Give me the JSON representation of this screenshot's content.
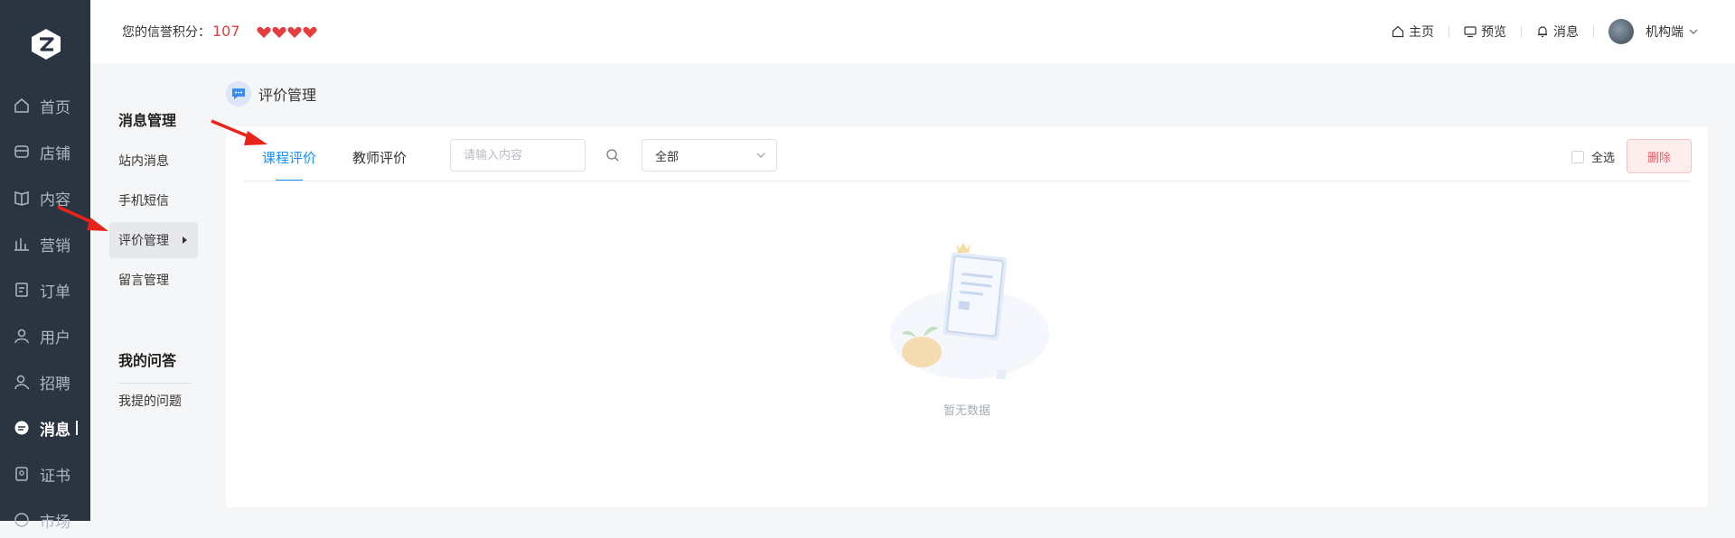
{
  "nav": {
    "items": [
      {
        "label": "首页",
        "icon": "home-icon"
      },
      {
        "label": "店铺",
        "icon": "store-icon"
      },
      {
        "label": "内容",
        "icon": "book-icon"
      },
      {
        "label": "营销",
        "icon": "chart-icon"
      },
      {
        "label": "订单",
        "icon": "order-icon"
      },
      {
        "label": "用户",
        "icon": "user-icon"
      },
      {
        "label": "招聘",
        "icon": "recruit-icon"
      },
      {
        "label": "消息",
        "icon": "message-icon"
      },
      {
        "label": "证书",
        "icon": "certificate-icon"
      },
      {
        "label": "市场",
        "icon": "market-icon"
      }
    ]
  },
  "topbar": {
    "credit_label": "您的信誉积分：",
    "credit_value": "107",
    "links": [
      {
        "label": "主页",
        "icon": "house-icon"
      },
      {
        "label": "预览",
        "icon": "monitor-icon"
      },
      {
        "label": "消息",
        "icon": "bell-icon"
      }
    ],
    "account": "机构端"
  },
  "subnav": {
    "section1_title": "消息管理",
    "section1_items": [
      "站内消息",
      "手机短信",
      "评价管理",
      "留言管理"
    ],
    "section2_title": "我的问答",
    "section2_items": [
      "我提的问题"
    ]
  },
  "page": {
    "title": "评价管理",
    "tabs": [
      "课程评价",
      "教师评价"
    ],
    "search_placeholder": "请输入内容",
    "select_value": "全部",
    "select_all": "全选",
    "delete": "删除",
    "empty": "暂无数据"
  },
  "colors": {
    "sidebar": "#2b3542",
    "accent": "#1890ff",
    "danger": "#e9616b",
    "credit": "#e53e3e"
  }
}
